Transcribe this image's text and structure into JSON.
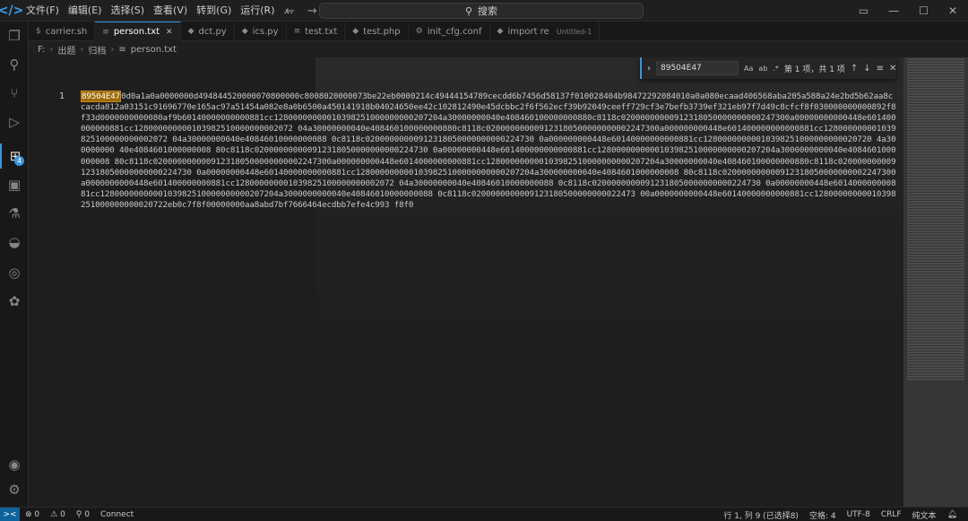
{
  "menu": [
    "文件(F)",
    "编辑(E)",
    "选择(S)",
    "查看(V)",
    "转到(G)",
    "运行(R)",
    "..."
  ],
  "search": {
    "placeholder": "搜索"
  },
  "tabs": [
    {
      "label": "carrier.sh",
      "icon": "$",
      "active": false
    },
    {
      "label": "person.txt",
      "icon": "≡",
      "active": true
    },
    {
      "label": "dct.py",
      "icon": "◆",
      "active": false
    },
    {
      "label": "ics.py",
      "icon": "◆",
      "active": false
    },
    {
      "label": "test.txt",
      "icon": "≡",
      "active": false
    },
    {
      "label": "test.php",
      "icon": "◆",
      "active": false
    },
    {
      "label": "init_cfg.conf",
      "icon": "⚙",
      "active": false
    },
    {
      "label": "import re",
      "icon": "◆",
      "active": false,
      "hint": "Untitled-1"
    }
  ],
  "breadcrumb": {
    "drive": "F:",
    "folder1": "出题",
    "folder2": "归档",
    "file": "person.txt"
  },
  "find": {
    "query": "89504E47",
    "count": "第 1 项，共 1 项",
    "opt_case": "Aa",
    "opt_word": "ab",
    "opt_regex": ".*"
  },
  "editor": {
    "line_number": "1",
    "match": "89504E47",
    "content": "0d0a1a0a0000000d494844520000070800000c8008020000073be22eb0000214c49444154789cecdd6b7456d58137f010028404b98472292084010a0a080ecaad406568aba205a588a24e2bd5b62aa8ccacda812a03151c91696770e165ac97a51454a082e8a0b6500a450141918b04024650ee42c102812490e45dcbbc2f6f562ecf39b92049ceeff729cf3e7befb3739ef321eb97f7d49c8cfcf8f030000000000892f8f33d0000000000080af9b60140000000000881cc12800000000010398251000000000207204a30000000040e408460100000000880c8118c02000000000912318050000000000247300a00000000000448e601400000000881cc128000000000103982510000000002072 04a30000000040e408460100000000880c8118c020000000009123180500000000002247300a000000000448e601400000000000881cc128000000001039825100000000002072 04a30000000040e40846010000000088 0c8118c02000000000912318050000000000224730 0a000000000448e60140000000000881cc12800000000010398251000000000020720 4a300000000 40e4084601000000008 80c8118c020000000000912318050000000000224730 0a00000000448e601400000000000881cc1280000000000103982510000000000207204a3000000000040e4084601000000008 80c8118c0200000000009123180500000000002247300a000000000448e6014000000000881cc128000000000103982510000000000207204a30000000040e408460100000000880c8118c02000000000912318050000000000224730 0a00000000448e60140000000000881cc1280000000001039825100000000000207204a300000000040e4084601000000008 80c8118c020000000000912318050000000002247300a0000000000448e601400000000881cc128000000001039825100000000002072 04a30000000040e40846010000000088 0c8118c02000000000912318050000000000224730 0a00000000448e601400000000881cc1280000000000103982510000000000207204a3000000000040e40846010000000088 0c8118c0200000000009123180500000000022473 00a0000000000448e60140000000000881cc12800000000010398251000000000020722eb0c7f8f00000000aa8abd7bf7666464ecdbb7efe4c993 f8f0"
  },
  "status": {
    "remote_icon": "><",
    "errors": "⊗ 0",
    "warnings": "⚠ 0",
    "ports": "⚲ 0",
    "connect": "Connect",
    "position": "行 1, 列 9 (已选择8)",
    "spaces": "空格: 4",
    "encoding": "UTF-8",
    "eol": "CRLF",
    "language": "纯文本"
  }
}
